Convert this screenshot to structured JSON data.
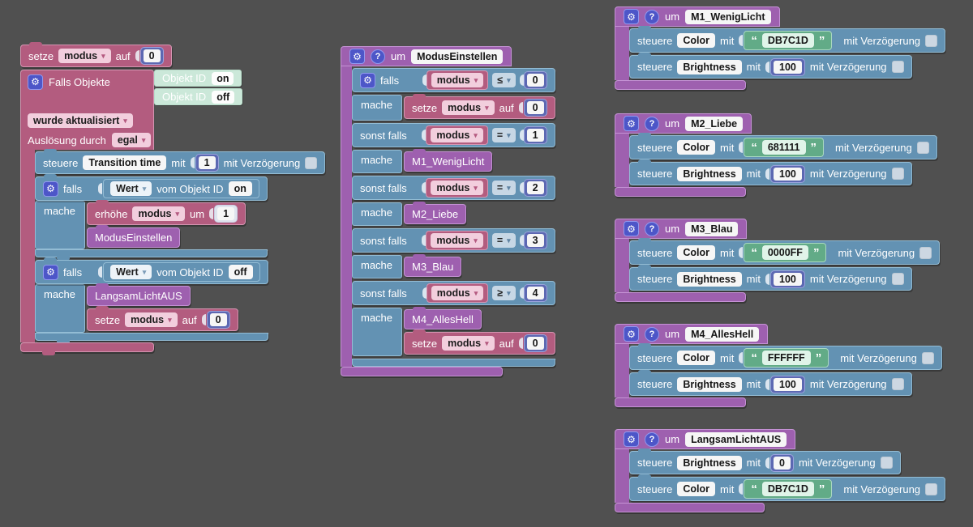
{
  "colors": {
    "canvas": "#505050",
    "trigger_pink": "#b35c7f",
    "action_blue": "#6392b3",
    "function_purple": "#9e60af",
    "string_green": "#62ab87",
    "number_indigo": "#5c68b2",
    "shadow_mint": "#cbe8d9",
    "icon_blue": "#4d56c8"
  },
  "icons": {
    "gear": "⚙",
    "help": "?",
    "arrow": "▾",
    "quote_open": "“",
    "quote_close": "”"
  },
  "labels": {
    "setze": "setze",
    "modus": "modus",
    "auf": "auf",
    "falls_objekte": "Falls Objekte",
    "objekt_id": "Objekt ID",
    "wurde_aktualisiert": "wurde aktualisiert",
    "ausloesung_durch": "Auslösung durch",
    "egal": "egal",
    "steuere": "steuere",
    "transition_time": "Transition time",
    "mit": "mit",
    "mit_verzoegerung": "mit Verzögerung",
    "falls": "falls",
    "mache": "mache",
    "sonst_falls": "sonst falls",
    "wert": "Wert",
    "vom_objekt_id": "vom Objekt ID",
    "erhoehe": "erhöhe",
    "um": "um",
    "color": "Color",
    "brightness": "Brightness"
  },
  "trigger": {
    "set_value": "0",
    "objekt1": "on",
    "objekt2": "off",
    "transition_value": "1",
    "wert1": "on",
    "erhoehe_value": "1",
    "call1": "ModusEinstellen",
    "wert2": "off",
    "call2": "LangsamLichtAUS",
    "reset_value": "0"
  },
  "modus_fn": {
    "name": "ModusEinstellen",
    "set1": "0",
    "set2": "0",
    "conds": [
      {
        "kw": "falls",
        "op": "≤",
        "val": "0"
      },
      {
        "kw": "sonst falls",
        "op": "=",
        "val": "1"
      },
      {
        "kw": "sonst falls",
        "op": "=",
        "val": "2"
      },
      {
        "kw": "sonst falls",
        "op": "=",
        "val": "3"
      },
      {
        "kw": "sonst falls",
        "op": "≥",
        "val": "4"
      }
    ],
    "calls": [
      "M1_WenigLicht",
      "M2_Liebe",
      "M3_Blau",
      "M4_AllesHell"
    ]
  },
  "functions": [
    {
      "name": "M1_WenigLicht",
      "rows": [
        {
          "kind": "string",
          "target": "Color",
          "value": "DB7C1D"
        },
        {
          "kind": "number",
          "target": "Brightness",
          "value": "100"
        }
      ]
    },
    {
      "name": "M2_Liebe",
      "rows": [
        {
          "kind": "string",
          "target": "Color",
          "value": "681111"
        },
        {
          "kind": "number",
          "target": "Brightness",
          "value": "100"
        }
      ]
    },
    {
      "name": "M3_Blau",
      "rows": [
        {
          "kind": "string",
          "target": "Color",
          "value": "0000FF"
        },
        {
          "kind": "number",
          "target": "Brightness",
          "value": "100"
        }
      ]
    },
    {
      "name": "M4_AllesHell",
      "rows": [
        {
          "kind": "string",
          "target": "Color",
          "value": "FFFFFF"
        },
        {
          "kind": "number",
          "target": "Brightness",
          "value": "100"
        }
      ]
    },
    {
      "name": "LangsamLichtAUS",
      "rows": [
        {
          "kind": "number",
          "target": "Brightness",
          "value": "0"
        },
        {
          "kind": "string",
          "target": "Color",
          "value": "DB7C1D"
        }
      ]
    }
  ]
}
